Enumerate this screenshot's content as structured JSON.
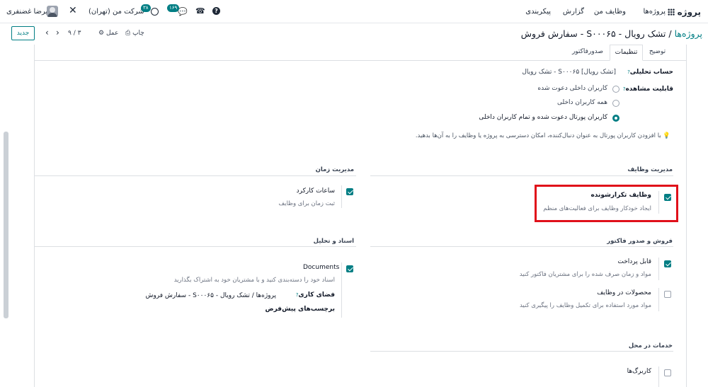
{
  "topbar": {
    "app_name": "پروژه",
    "menu": [
      "پروژه‌ها",
      "وظایف من",
      "گزارش",
      "پیکربندی"
    ],
    "user_name": "علیرضا غضنفری",
    "company": "شرکت من (تهران)",
    "activity_count": "۳۸",
    "message_count": "۱۶۹"
  },
  "control": {
    "new_label": "جدید",
    "pager": "۹ / ۳",
    "action_label": "عمل",
    "print_label": "چاپ",
    "breadcrumb_root": "پروژه‌ها",
    "breadcrumb_sep": "/",
    "record_title": "تشک رویال - S۰۰۰۶۵ - سفارش فروش"
  },
  "tabs": [
    "توضیح",
    "تنظیمات",
    "صدورفاکتور"
  ],
  "settings": {
    "analytic_label": "حساب تحلیلی",
    "analytic_value": "[تشک رویال] S۰۰۰۶۵ - تشک رویال",
    "visibility_label": "قابلیت مشاهده",
    "visibility_options": [
      "کاربران داخلی دعوت شده",
      "همه کاربران داخلی",
      "کاربران پورتال دعوت شده و تمام کاربران داخلی"
    ],
    "visibility_selected": 2,
    "hint": "با افزودن کاربران پورتال به عنوان دنبال‌کننده، امکان دسترسی به پروژه یا وظایف را به آن‌ها بدهید."
  },
  "sections": {
    "task_mgmt": "مدیریت وظایف",
    "time_mgmt": "مدیریت زمان",
    "sales_invoicing": "فروش و صدور فاکتور",
    "docs_analysis": "اسناد و تحلیل",
    "field_services": "خدمات در محل"
  },
  "options": {
    "recurring_title": "وظایف تکرارشونده",
    "recurring_desc": "ایجاد خودکار وظایف برای فعالیت‌های منظم",
    "timesheets_title": "ساعات کارکرد",
    "timesheets_desc": "ثبت زمان برای وظایف",
    "billable_title": "قابل پرداخت",
    "billable_desc": "مواد و زمان صرف شده را برای مشتریان فاکتور کنید",
    "products_title": "محصولات در وظایف",
    "products_desc": "مواد مورد استفاده برای تکمیل وظایف را پیگیری کنید",
    "documents_title": "Documents",
    "documents_desc": "اسناد خود را دسته‌بندی کنید و با مشتریان خود به اشتراک بگذارید",
    "workspace_label": "فضای کاری",
    "workspace_value": "پروژه‌ها / تشک رویال - S۰۰۰۶۵ - سفارش فروش",
    "default_tags_label": "برچسب‌های پیش‌فرض",
    "worksheets_title": "کاربرگ‌ها"
  },
  "colors": {
    "accent": "#017e84",
    "highlight": "#e0101a"
  }
}
